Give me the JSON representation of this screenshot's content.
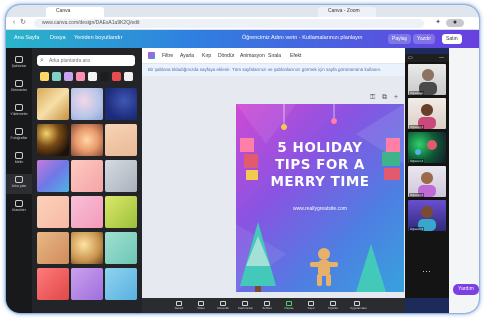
{
  "browser": {
    "tabs": [
      {
        "label": "Canva"
      },
      {
        "label": "Canva - Zoom"
      }
    ],
    "address": "www.canva.com/design/DAEsA1a9K2Q/edit"
  },
  "canva_topbar": {
    "items": [
      "Ana Sayfa",
      "Dosya",
      "Yeniden boyutlandır"
    ],
    "document_title": "Öğrencimiz Adını verin - Kutlamalarınızı planlayın",
    "buttons": {
      "share": "Paylaş",
      "print": "Yazdır",
      "more": "Satın"
    }
  },
  "left_rail": [
    {
      "label": "Şablonlar"
    },
    {
      "label": "Elemanlar"
    },
    {
      "label": "Yüklemeler"
    },
    {
      "label": "Fotoğraflar"
    },
    {
      "label": "Metin"
    },
    {
      "label": "Arka plan"
    },
    {
      "label": "Klasörler"
    }
  ],
  "panel": {
    "search_placeholder": "Arka planlarda ara",
    "swatches": [
      "#ffd866",
      "#7fd1c7",
      "#c9a3f0",
      "#ff8fb0",
      "#f4f4f4",
      "#1e1e1e",
      "#e84c4c",
      "#f0f0f0"
    ]
  },
  "editor_toolbar": {
    "items": [
      "Filtre",
      "Ayarla",
      "Kırp",
      "Döndür",
      "Animasyon",
      "Sırala",
      "Efekt"
    ]
  },
  "notice": "Bir şablona tıkladığınızda sayfaya eklenir. Tüm sayfalarınızı ve şablonlarınızı görmek için sayfa görünümünü kullanın.",
  "design": {
    "title_lines": [
      "5 HOLIDAY",
      "TIPS FOR A",
      "MERRY TIME"
    ],
    "url": "www.reallygreatsite.com"
  },
  "video_participants": [
    {
      "name": "Öğretmen"
    },
    {
      "name": "Öğrenci 1"
    },
    {
      "name": "Öğrenci 2"
    },
    {
      "name": "Öğrenci 3"
    },
    {
      "name": "Öğrenci 4"
    }
  ],
  "zoom_toolbar": [
    {
      "label": "Sessiz"
    },
    {
      "label": "Video"
    },
    {
      "label": "Güvenlik"
    },
    {
      "label": "Katılımcılar"
    },
    {
      "label": "Sohbet"
    },
    {
      "label": "Paylaş"
    },
    {
      "label": "Kayıt"
    },
    {
      "label": "Tepkiler"
    },
    {
      "label": "Uygulamalar"
    }
  ],
  "help_label": "Yardım"
}
